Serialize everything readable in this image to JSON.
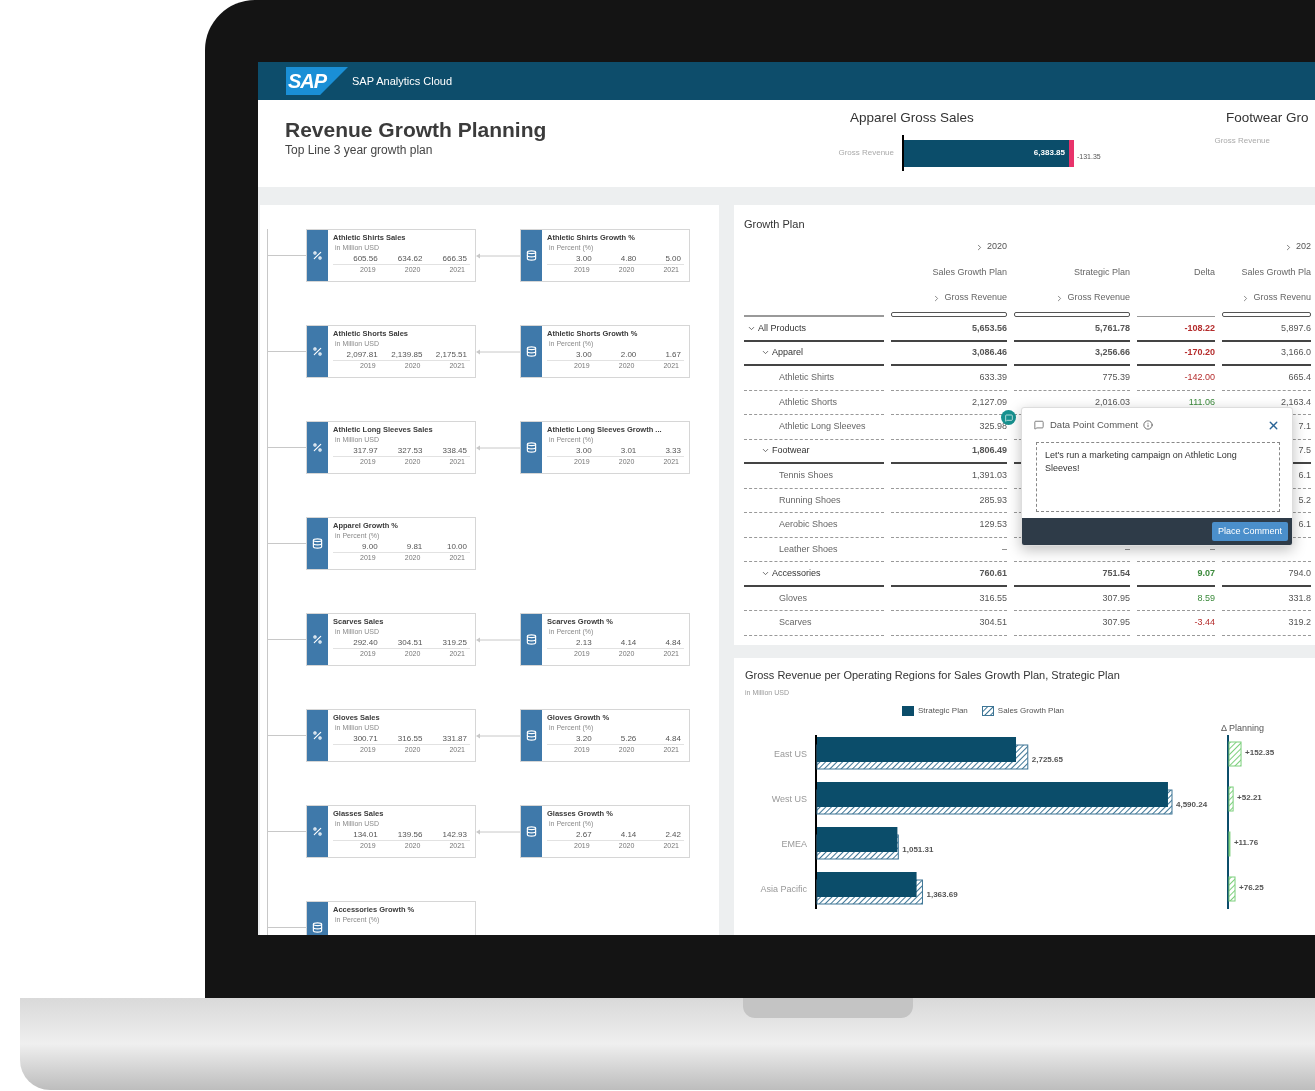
{
  "app": {
    "logo": "SAP",
    "title": "SAP Analytics Cloud"
  },
  "page": {
    "title": "Revenue Growth Planning",
    "subtitle": "Top Line 3 year growth plan"
  },
  "kpis": [
    {
      "title": "Apparel Gross Sales",
      "label": "Gross Revenue",
      "value": "6,383.85",
      "delta": "-131.35"
    },
    {
      "title": "Footwear Gro",
      "label": "Gross Revenue"
    }
  ],
  "model": {
    "rows": [
      {
        "left": {
          "kind": "calculated",
          "title": "Athletic Shirts Sales",
          "unit": "in Million USD",
          "values": [
            "605.56",
            "634.62",
            "666.35"
          ],
          "years": [
            "2019",
            "2020",
            "2021"
          ]
        },
        "right": {
          "kind": "input",
          "title": "Athletic Shirts Growth %",
          "unit": "in Percent (%)",
          "values": [
            "3.00",
            "4.80",
            "5.00"
          ],
          "years": [
            "2019",
            "2020",
            "2021"
          ]
        }
      },
      {
        "left": {
          "kind": "calculated",
          "title": "Athletic Shorts Sales",
          "unit": "in Million USD",
          "values": [
            "2,097.81",
            "2,139.85",
            "2,175.51"
          ],
          "years": [
            "2019",
            "2020",
            "2021"
          ]
        },
        "right": {
          "kind": "input",
          "title": "Athletic Shorts Growth %",
          "unit": "in Percent (%)",
          "values": [
            "3.00",
            "2.00",
            "1.67"
          ],
          "years": [
            "2019",
            "2020",
            "2021"
          ]
        }
      },
      {
        "left": {
          "kind": "calculated",
          "title": "Athletic Long Sleeves Sales",
          "unit": "in Million USD",
          "values": [
            "317.97",
            "327.53",
            "338.45"
          ],
          "years": [
            "2019",
            "2020",
            "2021"
          ]
        },
        "right": {
          "kind": "input",
          "title": "Athletic Long Sleeves Growth ...",
          "unit": "in Percent (%)",
          "values": [
            "3.00",
            "3.01",
            "3.33"
          ],
          "years": [
            "2019",
            "2020",
            "2021"
          ]
        }
      },
      {
        "left": {
          "kind": "input",
          "title": "Apparel Growth %",
          "unit": "in Percent (%)",
          "values": [
            "9.00",
            "9.81",
            "10.00"
          ],
          "years": [
            "2019",
            "2020",
            "2021"
          ]
        }
      },
      {
        "left": {
          "kind": "calculated",
          "title": "Scarves Sales",
          "unit": "in Million USD",
          "values": [
            "292.40",
            "304.51",
            "319.25"
          ],
          "years": [
            "2019",
            "2020",
            "2021"
          ]
        },
        "right": {
          "kind": "input",
          "title": "Scarves Growth %",
          "unit": "in Percent (%)",
          "values": [
            "2.13",
            "4.14",
            "4.84"
          ],
          "years": [
            "2019",
            "2020",
            "2021"
          ]
        }
      },
      {
        "left": {
          "kind": "calculated",
          "title": "Gloves Sales",
          "unit": "in Million USD",
          "values": [
            "300.71",
            "316.55",
            "331.87"
          ],
          "years": [
            "2019",
            "2020",
            "2021"
          ]
        },
        "right": {
          "kind": "input",
          "title": "Gloves Growth %",
          "unit": "in Percent (%)",
          "values": [
            "3.20",
            "5.26",
            "4.84"
          ],
          "years": [
            "2019",
            "2020",
            "2021"
          ]
        }
      },
      {
        "left": {
          "kind": "calculated",
          "title": "Glasses Sales",
          "unit": "in Million USD",
          "values": [
            "134.01",
            "139.56",
            "142.93"
          ],
          "years": [
            "2019",
            "2020",
            "2021"
          ]
        },
        "right": {
          "kind": "input",
          "title": "Glasses Growth %",
          "unit": "in Percent (%)",
          "values": [
            "2.67",
            "4.14",
            "2.42"
          ],
          "years": [
            "2019",
            "2020",
            "2021"
          ]
        }
      },
      {
        "left": {
          "kind": "input",
          "title": "Accessories Growth %",
          "unit": "in Percent (%)"
        }
      }
    ]
  },
  "table": {
    "title": "Growth Plan",
    "columns": [
      {
        "group": "2020",
        "label": "Sales Growth Plan",
        "measure": "Gross Revenue"
      },
      {
        "label": "Strategic Plan",
        "measure": "Gross Revenue"
      },
      {
        "label": "Delta"
      },
      {
        "group": "202",
        "label": "Sales Growth Pla",
        "measure": "Gross Revenu"
      }
    ],
    "rows": [
      {
        "label": "All Products",
        "expanded": true,
        "negative": true,
        "cells": [
          "5,653.56",
          "5,761.78",
          "-108.22",
          "5,897.6"
        ],
        "children": [
          {
            "label": "Apparel",
            "expanded": true,
            "negative": true,
            "cells": [
              "3,086.46",
              "3,256.66",
              "-170.20",
              "3,166.0"
            ],
            "children": [
              {
                "label": "Athletic Shirts",
                "negative": true,
                "cells": [
                  "633.39",
                  "775.39",
                  "-142.00",
                  "665.4"
                ]
              },
              {
                "label": "Athletic Shorts",
                "negative": false,
                "cells": [
                  "2,127.09",
                  "2,016.03",
                  "111.06",
                  "2,163.4"
                ]
              },
              {
                "label": "Athletic Long Sleeves",
                "has_comment": true,
                "cells": [
                  "325.98",
                  null,
                  null,
                  "7.1"
                ]
              }
            ]
          },
          {
            "label": "Footwear",
            "expanded": true,
            "cells": [
              "1,806.49",
              null,
              null,
              "7.5"
            ],
            "children": [
              {
                "label": "Tennis Shoes",
                "cells": [
                  "1,391.03",
                  null,
                  null,
                  "6.1"
                ]
              },
              {
                "label": "Running Shoes",
                "cells": [
                  "285.93",
                  null,
                  null,
                  "5.2"
                ]
              },
              {
                "label": "Aerobic Shoes",
                "cells": [
                  "129.53",
                  null,
                  null,
                  "6.1"
                ]
              },
              {
                "label": "Leather Shoes",
                "cells": [
                  "–",
                  "–",
                  "–",
                  null
                ]
              }
            ]
          },
          {
            "label": "Accessories",
            "expanded": true,
            "negative": false,
            "cells": [
              "760.61",
              "751.54",
              "9.07",
              "794.0"
            ],
            "children": [
              {
                "label": "Gloves",
                "negative": false,
                "cells": [
                  "316.55",
                  "307.95",
                  "8.59",
                  "331.8"
                ]
              },
              {
                "label": "Scarves",
                "negative": true,
                "cells": [
                  "304.51",
                  "307.95",
                  "-3.44",
                  "319.2"
                ]
              }
            ]
          }
        ]
      }
    ]
  },
  "comment_popup": {
    "title": "Data Point Comment",
    "value": "Let's run a marketing campaign on Athletic Long Sleeves!",
    "button": "Place Comment"
  },
  "chart_panel": {
    "unit": "in Million USD",
    "chart_data": {
      "type": "bar",
      "orientation": "horizontal",
      "title": "Gross Revenue per Operating Regions for Sales Growth Plan, Strategic Plan",
      "categories": [
        "East US",
        "West US",
        "EMEA",
        "Asia Pacific"
      ],
      "series": [
        {
          "name": "Strategic Plan",
          "color": "#0b4d6a",
          "values": [
            2573.3,
            4538.03,
            1039.55,
            1287.44
          ]
        },
        {
          "name": "Sales Growth Plan",
          "color": "#3d7595",
          "values": [
            2725.65,
            4590.24,
            1051.31,
            1363.69
          ],
          "value_labels": [
            "2,725.65",
            "4,590.24",
            "1,051.31",
            "1,363.69"
          ]
        }
      ]
    }
  },
  "delta_panel": {
    "chart_data": {
      "type": "bar",
      "orientation": "horizontal",
      "title": "Δ Planning",
      "series": [
        {
          "color": "#7ccf7c",
          "values": [
            152.35,
            52.21,
            11.76,
            76.25
          ],
          "value_labels": [
            "+152.35",
            "+52.21",
            "+11.76",
            "+76.25"
          ]
        }
      ]
    }
  }
}
